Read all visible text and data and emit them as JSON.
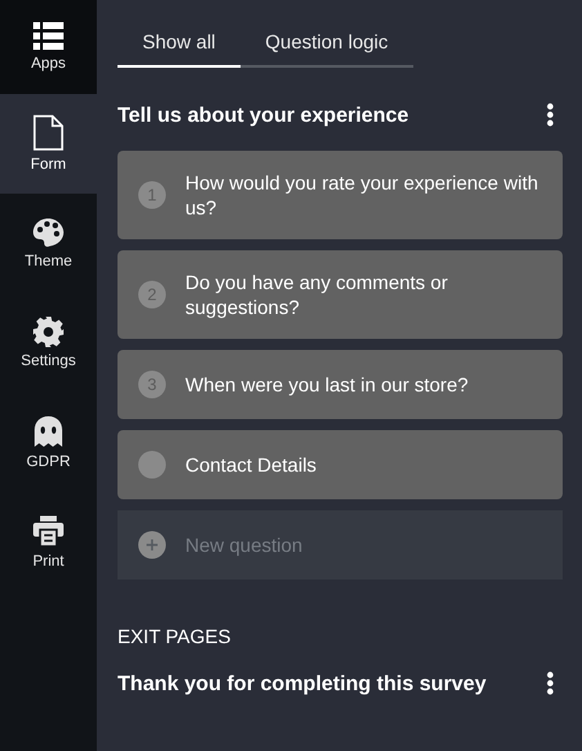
{
  "sidebar": {
    "items": [
      {
        "label": "Apps",
        "kind": "apps",
        "selected": false
      },
      {
        "label": "Form",
        "kind": "form",
        "selected": true
      },
      {
        "label": "Theme",
        "kind": "theme",
        "selected": false
      },
      {
        "label": "Settings",
        "kind": "settings",
        "selected": false
      },
      {
        "label": "GDPR",
        "kind": "gdpr",
        "selected": false
      },
      {
        "label": "Print",
        "kind": "print",
        "selected": false
      }
    ]
  },
  "tabs": [
    {
      "label": "Show all",
      "selected": true
    },
    {
      "label": "Question logic",
      "selected": false
    }
  ],
  "section": {
    "title": "Tell us about your experience",
    "questions": [
      {
        "kind": "question",
        "number": "1",
        "text": "How would you rate your experience with us?"
      },
      {
        "kind": "question",
        "number": "2",
        "text": "Do you have any comments or suggestions?"
      },
      {
        "kind": "question",
        "number": "3",
        "text": "When were you last in our store?"
      },
      {
        "kind": "contact",
        "text": "Contact Details"
      },
      {
        "kind": "new",
        "text": "New question"
      }
    ]
  },
  "exit_pages": {
    "heading": "EXIT PAGES",
    "pages": [
      {
        "title": "Thank you for completing this survey"
      }
    ]
  }
}
